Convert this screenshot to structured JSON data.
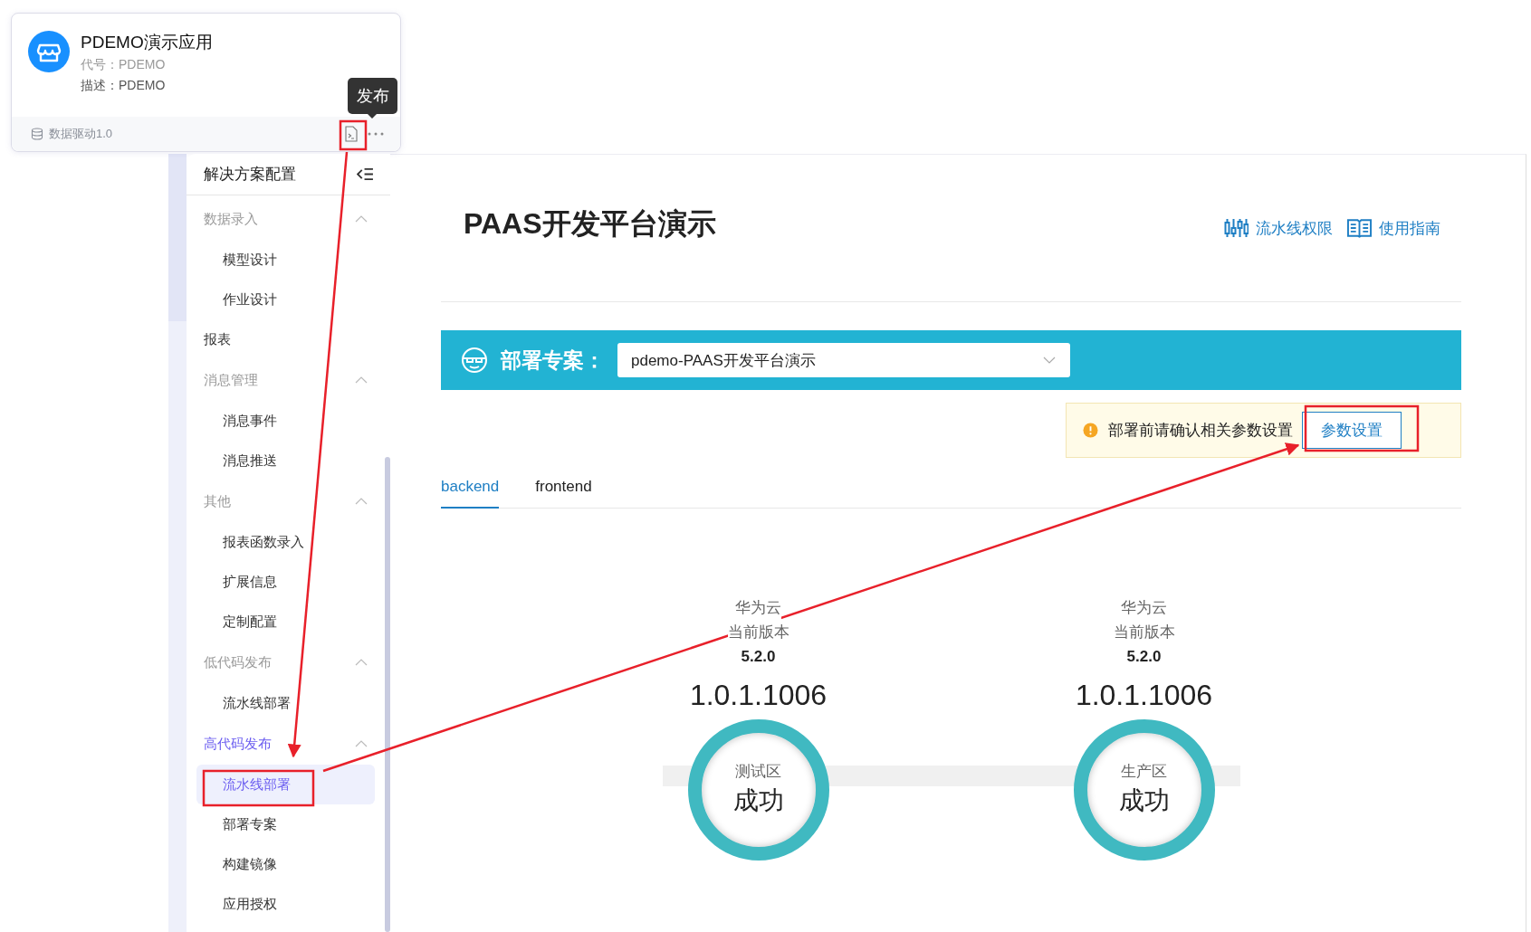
{
  "app_card": {
    "title": "PDEMO演示应用",
    "code": "代号：PDEMO",
    "description": "描述：PDEMO",
    "engine": "数据驱动1.0",
    "tooltip": "发布"
  },
  "sidebar": {
    "title": "解决方案配置",
    "items": [
      {
        "kind": "group",
        "label": "数据录入",
        "expanded": true,
        "selected": false,
        "children": [
          {
            "label": "模型设计",
            "selected": false
          },
          {
            "label": "作业设计",
            "selected": false
          }
        ]
      },
      {
        "kind": "link",
        "label": "报表",
        "selected": false
      },
      {
        "kind": "group",
        "label": "消息管理",
        "expanded": true,
        "selected": false,
        "children": [
          {
            "label": "消息事件",
            "selected": false
          },
          {
            "label": "消息推送",
            "selected": false
          }
        ]
      },
      {
        "kind": "group",
        "label": "其他",
        "expanded": true,
        "selected": false,
        "children": [
          {
            "label": "报表函数录入",
            "selected": false
          },
          {
            "label": "扩展信息",
            "selected": false
          },
          {
            "label": "定制配置",
            "selected": false
          }
        ]
      },
      {
        "kind": "group",
        "label": "低代码发布",
        "expanded": true,
        "selected": false,
        "children": [
          {
            "label": "流水线部署",
            "selected": false
          }
        ]
      },
      {
        "kind": "group",
        "label": "高代码发布",
        "expanded": true,
        "selected": true,
        "children": [
          {
            "label": "流水线部署",
            "selected": true
          },
          {
            "label": "部署专案",
            "selected": false
          },
          {
            "label": "构建镜像",
            "selected": false
          },
          {
            "label": "应用授权",
            "selected": false
          }
        ]
      }
    ]
  },
  "page": {
    "title": "PAAS开发平台演示",
    "links": [
      {
        "kind": "pipeline",
        "label": "流水线权限"
      },
      {
        "kind": "guide",
        "label": "使用指南"
      }
    ],
    "deploy": {
      "label": "部署专案：",
      "value": "pdemo-PAAS开发平台演示"
    },
    "alert": {
      "text": "部署前请确认相关参数设置",
      "button": "参数设置"
    },
    "tabs": [
      {
        "label": "backend",
        "selected": true
      },
      {
        "label": "frontend",
        "selected": false
      }
    ],
    "environments": [
      {
        "cloud": "华为云",
        "version_label": "当前版本",
        "version": "5.2.0",
        "build": "1.0.1.1006",
        "zone": "测试区",
        "status": "成功"
      },
      {
        "cloud": "华为云",
        "version_label": "当前版本",
        "version": "5.2.0",
        "build": "1.0.1.1006",
        "zone": "生产区",
        "status": "成功"
      }
    ]
  }
}
